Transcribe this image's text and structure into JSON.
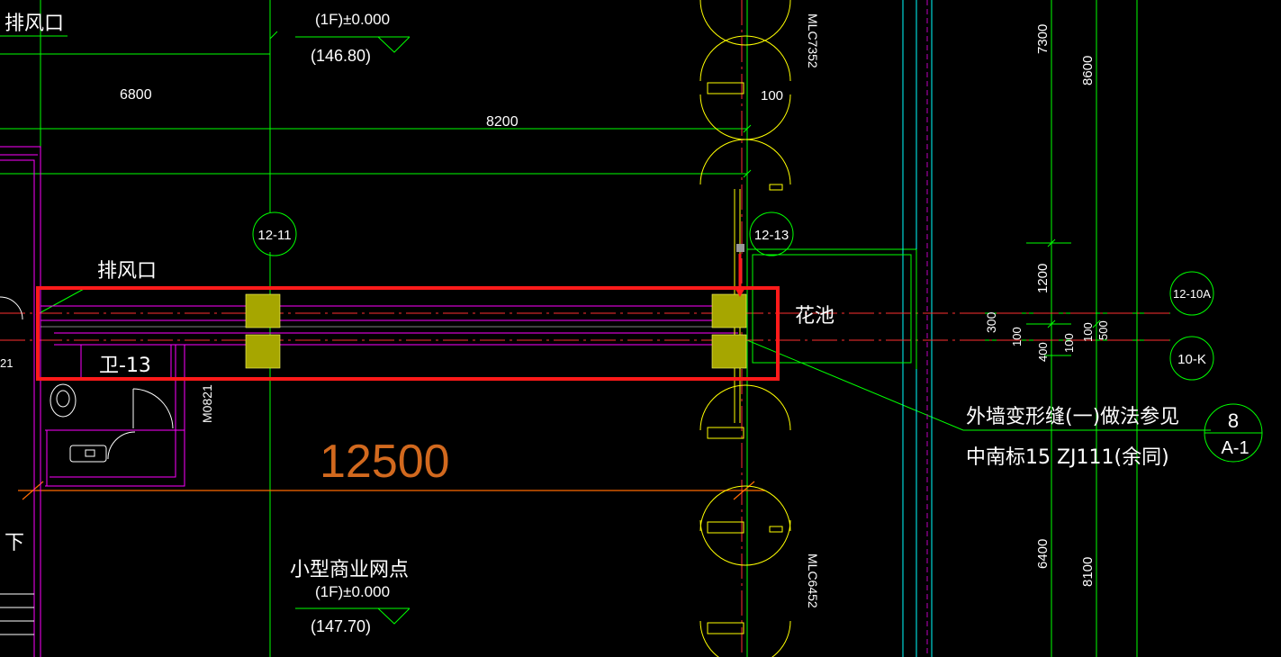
{
  "labels": {
    "exhaust_top": "排风口",
    "exhaust_mid": "排风口",
    "shop_name_bottom": "小型商业网点",
    "level_top": "(1F)±0.000",
    "level_bottom": "(1F)±0.000",
    "elev_top": "(146.80)",
    "elev_bottom": "(147.70)",
    "flower_bed": "花池",
    "note_line1": "外墙变形缝(一)做法参见",
    "note_line2": "中南标15 ZJ111(余同)",
    "room_tag": "卫-13",
    "door_tag": "M0821",
    "window_top": "MLC7352",
    "window_bottom": "MLC6452",
    "left_edge_num": "21",
    "left_edge_char": "下",
    "big_dim": "12500"
  },
  "dimensions": {
    "d6800": "6800",
    "d8200": "8200",
    "d100_top": "100",
    "d7300": "7300",
    "d8600": "8600",
    "d1200": "1200",
    "d300": "300",
    "d100_a": "100",
    "d400": "400",
    "d100_b": "100",
    "d100_c": "100",
    "d500": "500",
    "d6400": "6400",
    "d8100": "8100"
  },
  "grid_bubbles": {
    "b1": "12-11",
    "b2": "12-13",
    "b3": "12-10A",
    "b4": "10-K",
    "detail_num": "8",
    "detail_sheet": "A-1"
  },
  "colors": {
    "background": "#000000",
    "grid_axis": "#ff3030",
    "dim_line": "#00ff00",
    "wall": "#ff00ff",
    "window": "#ffff00",
    "column": "#a6a600",
    "highlight": "#ff1a1a",
    "big_dim_text": "#d2691e",
    "cyan": "#00ffff"
  }
}
